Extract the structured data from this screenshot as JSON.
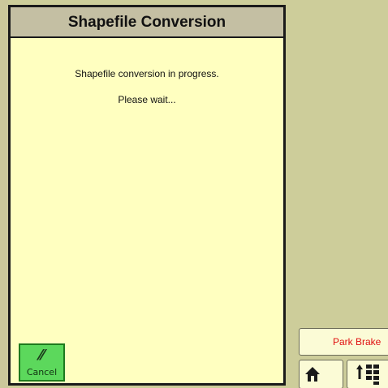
{
  "dialog": {
    "title": "Shapefile Conversion",
    "message_line1": "Shapefile conversion in progress.",
    "message_line2": "Please wait..."
  },
  "cancel_button": {
    "label": "Cancel",
    "icon": "cancel-slash-icon"
  },
  "status_bar": {
    "park_brake_label": "Park Brake"
  },
  "nav": {
    "home_icon": "home-icon",
    "menu_icon": "menu-grid-up-icon"
  },
  "colors": {
    "dialog_bg": "#ffffc0",
    "title_bar_bg": "#c4bfa3",
    "screen_bg": "#cdcd9a",
    "cancel_green": "#5cd85c",
    "park_brake_text": "#e01010"
  }
}
